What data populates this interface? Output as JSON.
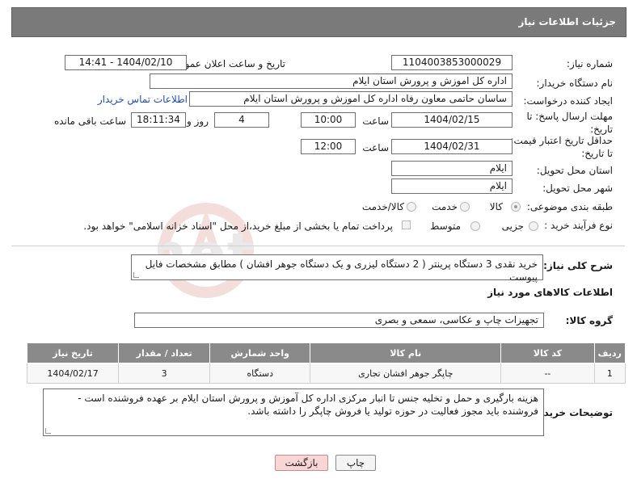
{
  "header": {
    "title": "جزئیات اطلاعات نیاز"
  },
  "labels": {
    "need_number": "شماره نیاز:",
    "announce_datetime": "تاریخ و ساعت اعلان عمومی:",
    "buyer_org": "نام دستگاه خریدار:",
    "requester": "ایجاد کننده درخواست:",
    "reply_deadline": "مهلت ارسال پاسخ: تا تاریخ:",
    "time": "ساعت",
    "days_and": "روز و",
    "hours_left": "ساعت باقی مانده",
    "price_validity": "حداقل تاریخ اعتبار قیمت: تا تاریخ:",
    "delivery_province": "استان محل تحویل:",
    "delivery_city": "شهر محل تحویل:",
    "category": "طبقه بندی موضوعی:",
    "purchase_type": "نوع فرآیند خرید :",
    "general_desc": "شرح کلی نیاز:",
    "goods_info": "اطلاعات کالاهای مورد نیاز",
    "goods_group": "گروه کالا:",
    "buyer_notes": "توضیحات خریدار:"
  },
  "fields": {
    "need_number": "1104003853000029",
    "announce_datetime": "1404/02/10 - 14:41",
    "buyer_org": "اداره کل اموزش و پرورش استان ایلام",
    "requester": "ساسان حاتمی معاون رفاه  اداره کل اموزش و پرورش استان ایلام",
    "contact_link": "اطلاعات تماس خریدار",
    "reply_date": "1404/02/15",
    "reply_time": "10:00",
    "days": "4",
    "remaining": "18:11:34",
    "price_date": "1404/02/31",
    "price_time": "12:00",
    "province": "ایلام",
    "city": "ایلام",
    "general_desc": "خرید نقدی 3 دستگاه پرینتر ( 2 دستگاه لیزری و یک دستگاه جوهر افشان ) مطابق مشخصات فایل پیوست",
    "goods_group": "تجهیزات چاپ و عکاسی، سمعی و بصری",
    "buyer_notes": "هزینه بارگیری و حمل و تخلیه جنس تا انبار مرکزی اداره کل آموزش و پرورش استان ایلام بر عهده فروشنده است - فروشنده باید مجوز فعالیت در حوزه تولید یا فروش چاپگر را داشته باشد."
  },
  "category_options": [
    {
      "label": "کالا",
      "selected": true
    },
    {
      "label": "خدمت",
      "selected": false
    },
    {
      "label": "کالا/خدمت",
      "selected": false
    }
  ],
  "purchase_options": [
    {
      "label": "جزیی",
      "selected": false
    },
    {
      "label": "متوسط",
      "selected": false
    }
  ],
  "payment_note": "پرداخت تمام یا بخشی از مبلغ خرید،از محل \"اسناد خزانه اسلامی\" خواهد بود.",
  "table": {
    "headers": [
      "ردیف",
      "کد کالا",
      "نام کالا",
      "واحد شمارش",
      "تعداد / مقدار",
      "تاریخ نیاز"
    ],
    "rows": [
      [
        "1",
        "--",
        "چاپگر جوهر افشان تجاری",
        "دستگاه",
        "3",
        "1404/02/17"
      ]
    ]
  },
  "buttons": {
    "print": "چاپ",
    "back": "بازگشت"
  },
  "watermark": "AriaTender.net"
}
